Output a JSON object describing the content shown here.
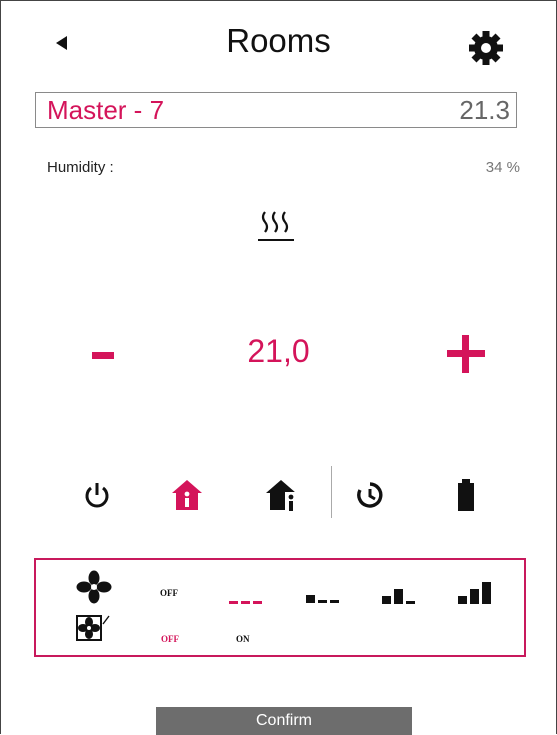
{
  "header": {
    "title": "Rooms",
    "back_icon": "back-arrow-icon",
    "settings_icon": "gear-icon"
  },
  "room": {
    "name": "Master - 7",
    "current_temp": "21.3"
  },
  "humidity": {
    "label": "Humidity :",
    "value": "34 %"
  },
  "heating_icon": "heating-icon",
  "control": {
    "setpoint": "21,0"
  },
  "modes": [
    {
      "icon": "power-icon",
      "active": false
    },
    {
      "icon": "home-icon",
      "active": true
    },
    {
      "icon": "home-info-icon",
      "active": false
    },
    {
      "icon": "timer-icon",
      "active": false
    },
    {
      "icon": "battery-icon",
      "active": false
    }
  ],
  "fan": {
    "speed_off_label": "OFF",
    "auto_off_label": "OFF",
    "auto_on_label": "ON",
    "selected_speed": "off"
  },
  "colors": {
    "accent": "#d4145a",
    "text": "#111111",
    "button": "#6d6d6d"
  },
  "confirm_label": "Confirm"
}
